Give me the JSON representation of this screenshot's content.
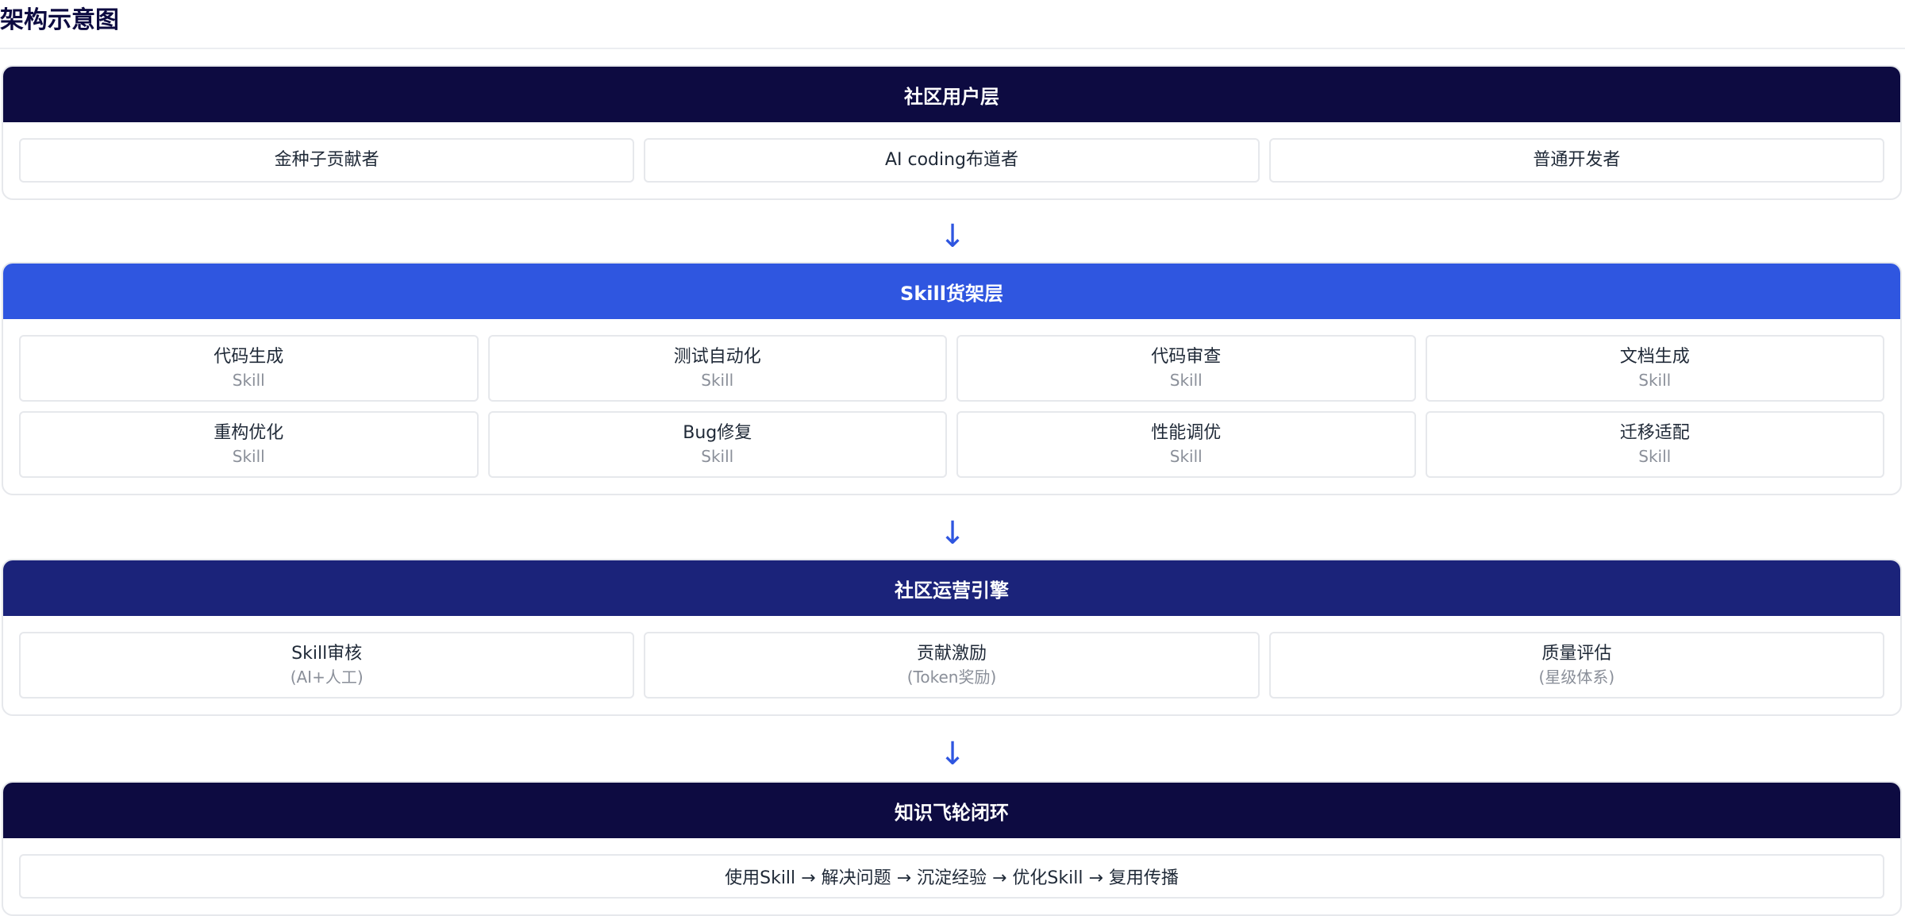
{
  "page": {
    "title": "架构示意图"
  },
  "colors": {
    "user_layer_header": "#0d0b41",
    "skill_layer_header": "#2f56e0",
    "ops_layer_header": "#1b237a",
    "loop_layer_header": "#0d0b41",
    "arrow": "#2f56e0"
  },
  "arrow_glyph": "↓",
  "user_layer": {
    "title": "社区用户层",
    "items": [
      "金种子贡献者",
      "AI coding布道者",
      "普通开发者"
    ]
  },
  "skill_layer": {
    "title": "Skill货架层",
    "items": [
      {
        "name": "代码生成",
        "tag": "Skill"
      },
      {
        "name": "测试自动化",
        "tag": "Skill"
      },
      {
        "name": "代码审查",
        "tag": "Skill"
      },
      {
        "name": "文档生成",
        "tag": "Skill"
      },
      {
        "name": "重构优化",
        "tag": "Skill"
      },
      {
        "name": "Bug修复",
        "tag": "Skill"
      },
      {
        "name": "性能调优",
        "tag": "Skill"
      },
      {
        "name": "迁移适配",
        "tag": "Skill"
      }
    ]
  },
  "ops_layer": {
    "title": "社区运营引擎",
    "items": [
      {
        "name": "Skill审核",
        "note": "(AI+人工)"
      },
      {
        "name": "贡献激励",
        "note": "(Token奖励)"
      },
      {
        "name": "质量评估",
        "note": "(星级体系)"
      }
    ]
  },
  "loop_layer": {
    "title": "知识飞轮闭环",
    "flow": "使用Skill → 解决问题 → 沉淀经验 → 优化Skill → 复用传播"
  }
}
